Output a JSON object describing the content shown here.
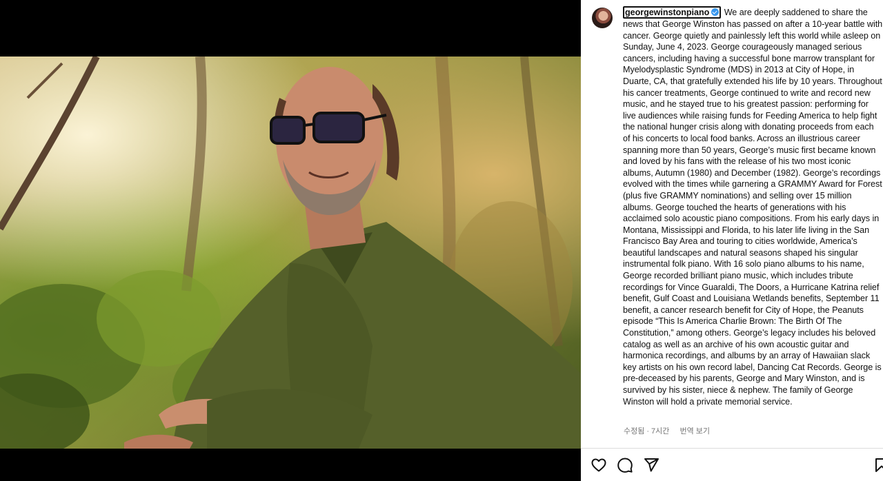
{
  "post": {
    "username": "georgewinstonpiano",
    "verified": true,
    "caption": "We are deeply saddened to share the news that George Winston has passed on after a 10-year battle with cancer. George quietly and painlessly left this world while asleep on Sunday, June 4, 2023. George courageously managed serious cancers, including having a successful bone marrow transplant for Myelodysplastic Syndrome (MDS) in 2013 at City of Hope, in Duarte, CA, that gratefully extended his life by 10 years. Throughout his cancer treatments, George continued to write and record new music, and he stayed true to his greatest passion: performing for live audiences while raising funds for Feeding America to help fight the national hunger crisis along with donating proceeds from each of his concerts to local food banks. Across an illustrious career spanning more than 50 years, George’s music first became known and loved by his fans with the release of his two most iconic albums, Autumn (1980) and December (1982). George’s recordings evolved with the times while garnering a GRAMMY Award for Forest (plus five GRAMMY nominations) and selling over 15 million albums. George touched the hearts of generations with his acclaimed solo acoustic piano compositions. From his early days in Montana, Mississippi and Florida, to his later life living in the San Francisco Bay Area and touring to cities worldwide, America’s beautiful landscapes and natural seasons shaped his singular instrumental folk piano. With 16 solo piano albums to his name, George recorded brilliant piano music, which includes tribute recordings for Vince Guaraldi, The Doors, a Hurricane Katrina relief benefit, Gulf Coast and Louisiana Wetlands benefits, September 11 benefit, a cancer research benefit for City of Hope, the Peanuts episode “This Is America Charlie Brown: The Birth Of The Constitution,” among others. George’s legacy includes his beloved catalog as well as an archive of his own acoustic guitar and harmonica recordings, and albums by an array of Hawaiian slack key artists on his own record label, Dancing Cat Records. George is pre-deceased by his parents, George and Mary Winston, and is survived by his sister, niece & nephew. The family of George Winston will hold a private memorial service.",
    "edited_label": "수정됨",
    "separator": "·",
    "time_ago": "7시간",
    "translate_label": "번역 보기"
  },
  "icons": {
    "like": "heart-icon",
    "comment": "comment-icon",
    "share": "send-icon",
    "save": "bookmark-icon",
    "verified": "verified-badge-icon"
  },
  "colors": {
    "verified": "#3897f0",
    "meta_text": "#737373",
    "media_background": "#000000"
  }
}
